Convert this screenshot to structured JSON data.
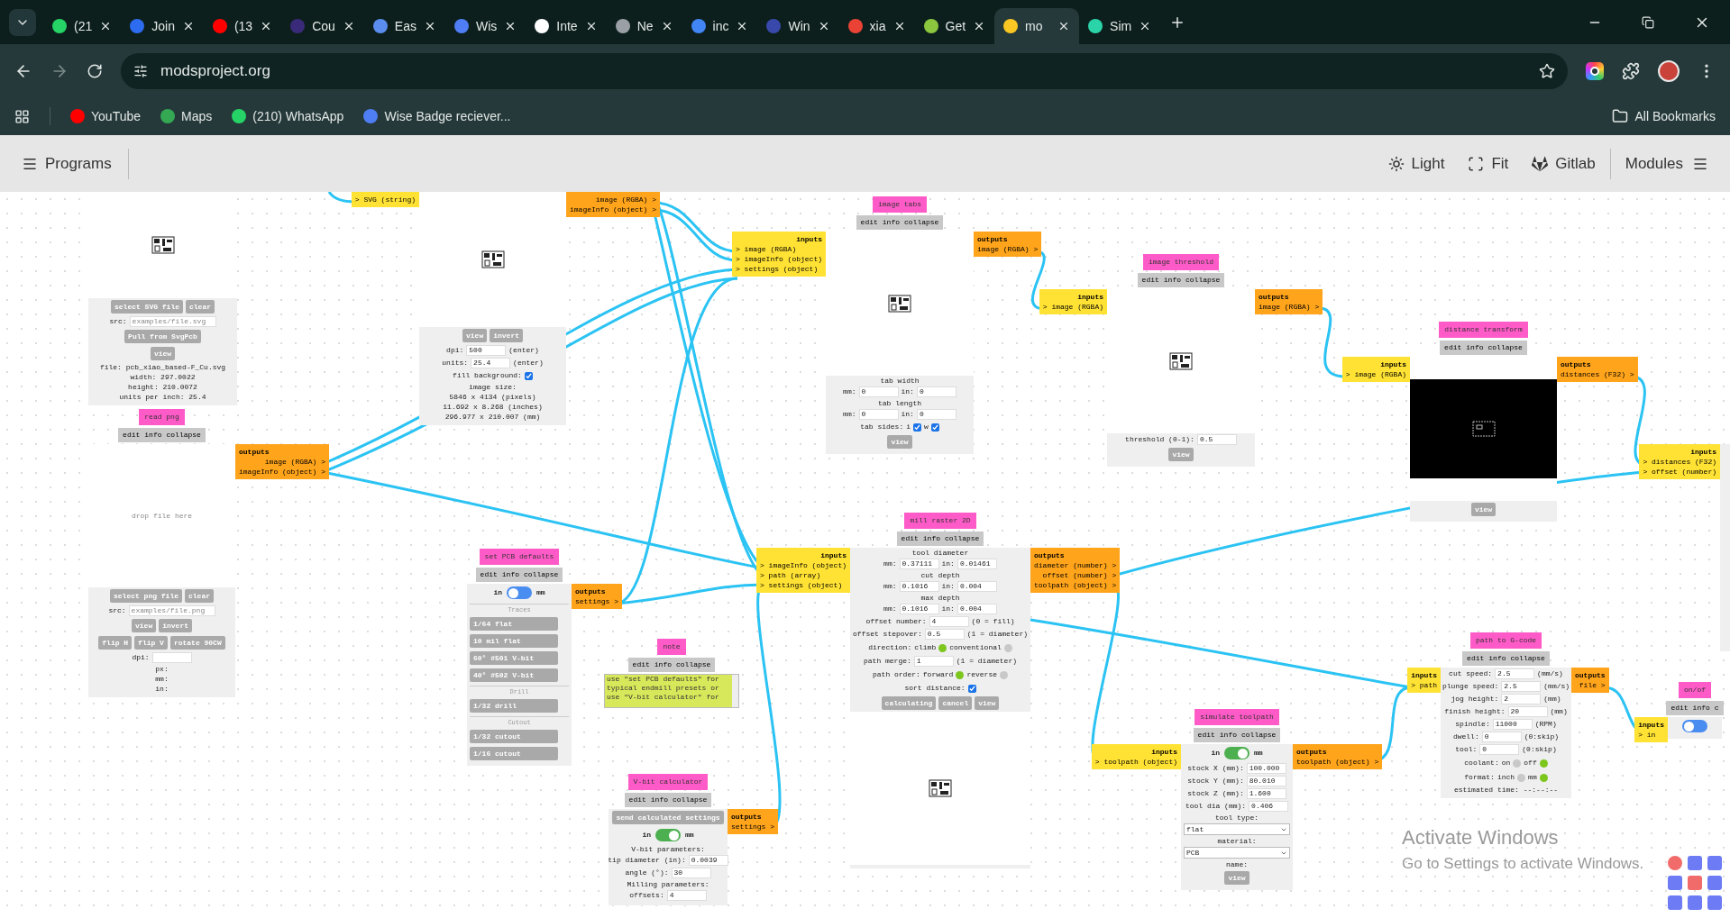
{
  "browser": {
    "tabs": [
      {
        "label": "(21",
        "color": "#25d366",
        "selected": false
      },
      {
        "label": "Join",
        "color": "#2d6bf0",
        "selected": false
      },
      {
        "label": "(13",
        "color": "#ff0000",
        "selected": false
      },
      {
        "label": "Cou",
        "color": "#3a2b7a",
        "selected": false
      },
      {
        "label": "Eas",
        "color": "#5b8def",
        "selected": false
      },
      {
        "label": "Wis",
        "color": "#4f7df3",
        "selected": false
      },
      {
        "label": "Inte",
        "color": "#ffffff",
        "selected": false
      },
      {
        "label": "Ne",
        "color": "#9aa0a6",
        "selected": false
      },
      {
        "label": "inc",
        "color": "#4285f4",
        "selected": false
      },
      {
        "label": "Win",
        "color": "#3949ab",
        "selected": false
      },
      {
        "label": "xia",
        "color": "#ea4335",
        "selected": false
      },
      {
        "label": "Get",
        "color": "#8cc63f",
        "selected": false
      },
      {
        "label": "mo",
        "color": "#f9c623",
        "selected": true
      },
      {
        "label": "Sim",
        "color": "#2ad4a8",
        "selected": false
      }
    ],
    "url": "modsproject.org",
    "bookmarks": [
      {
        "label": "YouTube",
        "color": "#ff0000"
      },
      {
        "label": "Maps",
        "color": "#34a853"
      },
      {
        "label": "(210) WhatsApp",
        "color": "#25d366"
      },
      {
        "label": "Wise Badge reciever...",
        "color": "#4f7df3"
      }
    ],
    "all_bookmarks": "All Bookmarks"
  },
  "header": {
    "programs": "Programs",
    "actions": [
      "Light",
      "Fit",
      "Gitlab"
    ],
    "modules": "Modules"
  },
  "nodes": [
    {
      "body": [
        {
          "kind": "image"
        },
        {
          "kind": "buttons",
          "items": [
            "select SVG file",
            "clear"
          ]
        },
        {
          "kind": "fields",
          "items": [
            {
              "label": "src:",
              "placeholder": "examples/file.svg"
            }
          ]
        },
        {
          "kind": "buttons",
          "items": [
            "Pull from SvgPcb"
          ]
        },
        {
          "kind": "buttons",
          "items": [
            "view"
          ]
        },
        {
          "kind": "text",
          "text": "file: pcb_xiao_based-F_Cu.svg"
        },
        {
          "kind": "text",
          "text": "width: 297.0022"
        },
        {
          "kind": "text",
          "text": "height: 210.0072"
        },
        {
          "kind": "text",
          "text": "units per inch: 25.4"
        }
      ]
    },
    {
      "inputs": {
        "ports": [
          "> SVG (string)"
        ]
      },
      "outputs": {
        "ports": [
          "image (RGBA) >",
          "imageInfo (object) >"
        ]
      },
      "body": [
        {
          "kind": "image"
        },
        {
          "kind": "buttons",
          "items": [
            "view",
            "invert"
          ]
        },
        {
          "kind": "fields",
          "items": [
            {
              "label": "dpi:",
              "value": "500",
              "suffix": "(enter)"
            }
          ]
        },
        {
          "kind": "fields",
          "items": [
            {
              "label": "units:",
              "value": "25.4",
              "suffix": "(enter)"
            }
          ]
        },
        {
          "kind": "checks",
          "label": "fill background:",
          "items": [
            {
              "checked": true
            }
          ]
        },
        {
          "kind": "text",
          "text": "image size:"
        },
        {
          "kind": "text",
          "text": "5846 x 4134 (pixels)"
        },
        {
          "kind": "text",
          "text": "11.692 x 8.268 (inches)"
        },
        {
          "kind": "text",
          "text": "296.977 x 210.007 (mm)"
        }
      ]
    },
    {
      "title": "read png",
      "menu": [
        "edit",
        "info",
        "collapse"
      ],
      "outputs": {
        "label": "outputs",
        "ports": [
          "image (RGBA) >",
          "imageInfo (object) >"
        ]
      },
      "body": [
        {
          "kind": "drop",
          "text": "drop file here"
        },
        {
          "kind": "buttons",
          "items": [
            "select png file",
            "clear"
          ]
        },
        {
          "kind": "fields",
          "items": [
            {
              "label": "src:",
              "placeholder": "examples/file.png"
            }
          ]
        },
        {
          "kind": "buttons",
          "items": [
            "view",
            "invert"
          ]
        },
        {
          "kind": "buttons",
          "items": [
            "flip H",
            "flip V",
            "rotate 90CW"
          ]
        },
        {
          "kind": "fields",
          "items": [
            {
              "label": "dpi:"
            }
          ]
        },
        {
          "kind": "text",
          "text": "px:"
        },
        {
          "kind": "text",
          "text": "mm:"
        },
        {
          "kind": "text",
          "text": "in:"
        }
      ]
    },
    {
      "title": "image tabs",
      "menu": [
        "edit",
        "info",
        "collapse"
      ],
      "inputs": {
        "label": "inputs",
        "ports": [
          "> image (RGBA)",
          "> imageInfo (object)",
          "> settings (object)"
        ]
      },
      "outputs": {
        "label": "outputs",
        "ports": [
          "image (RGBA) >"
        ]
      },
      "body": [
        {
          "kind": "image"
        },
        {
          "kind": "text",
          "text": "tab width"
        },
        {
          "kind": "fields",
          "items": [
            {
              "label": "mm:",
              "value": "0"
            },
            {
              "label": "in:",
              "value": "0"
            }
          ]
        },
        {
          "kind": "text",
          "text": "tab length"
        },
        {
          "kind": "fields",
          "items": [
            {
              "label": "mm:",
              "value": "0"
            },
            {
              "label": "in:",
              "value": "0"
            }
          ]
        },
        {
          "kind": "checks",
          "label": "tab sides:",
          "items": [
            {
              "label": "i",
              "checked": true
            },
            {
              "label": "w",
              "checked": true
            }
          ]
        },
        {
          "kind": "buttons",
          "items": [
            "view"
          ]
        }
      ]
    },
    {
      "title": "image threshold",
      "menu": [
        "edit",
        "info",
        "collapse"
      ],
      "inputs": {
        "label": "inputs",
        "ports": [
          "> image (RGBA)"
        ]
      },
      "outputs": {
        "label": "outputs",
        "ports": [
          "image (RGBA) >"
        ]
      },
      "body": [
        {
          "kind": "image"
        },
        {
          "kind": "fields",
          "items": [
            {
              "label": "threshold (0-1):",
              "value": "0.5"
            }
          ]
        },
        {
          "kind": "buttons",
          "items": [
            "view"
          ]
        }
      ]
    },
    {
      "title": "distance transform",
      "menu": [
        "edit",
        "info",
        "collapse"
      ],
      "inputs": {
        "label": "inputs",
        "ports": [
          "> image (RGBA)"
        ]
      },
      "outputs": {
        "label": "outputs",
        "ports": [
          "distances (F32) >"
        ]
      },
      "body": [
        {
          "kind": "dark"
        },
        {
          "kind": "buttons",
          "items": [
            "view"
          ]
        }
      ]
    },
    {
      "inputs": {
        "label": "inputs",
        "ports": [
          "> distances (F32)",
          "> offset (number)"
        ]
      }
    },
    {
      "title": "mill raster 2D",
      "menu": [
        "edit",
        "info",
        "collapse"
      ],
      "inputs": {
        "label": "inputs",
        "ports": [
          "> imageInfo (object)",
          "> path (array)",
          "> settings (object)"
        ]
      },
      "outputs": {
        "label": "outputs",
        "ports": [
          "diameter (number) >",
          "offset (number) >",
          "toolpath (object) >"
        ]
      },
      "body": [
        {
          "kind": "text",
          "text": "tool diameter"
        },
        {
          "kind": "fields",
          "items": [
            {
              "label": "mm:",
              "value": "0.37111"
            },
            {
              "label": "in:",
              "value": "0.01461"
            }
          ]
        },
        {
          "kind": "text",
          "text": "cut depth"
        },
        {
          "kind": "fields",
          "items": [
            {
              "label": "mm:",
              "value": "0.1016"
            },
            {
              "label": "in:",
              "value": "0.004"
            }
          ]
        },
        {
          "kind": "text",
          "text": "max depth"
        },
        {
          "kind": "fields",
          "items": [
            {
              "label": "mm:",
              "value": "0.1016"
            },
            {
              "label": "in:",
              "value": "0.004"
            }
          ]
        },
        {
          "kind": "fields",
          "items": [
            {
              "label": "offset number:",
              "value": "4",
              "suffix": "(0 = fill)"
            }
          ]
        },
        {
          "kind": "fields",
          "items": [
            {
              "label": "offset stepover:",
              "value": "0.5",
              "suffix": "(1 = diameter)"
            }
          ]
        },
        {
          "kind": "radio",
          "label": "direction:",
          "options": [
            {
              "label": "climb",
              "selected": true
            },
            {
              "label": "conventional",
              "selected": false
            }
          ]
        },
        {
          "kind": "fields",
          "items": [
            {
              "label": "path merge:",
              "value": "1",
              "suffix": "(1 = diameter)"
            }
          ]
        },
        {
          "kind": "radio",
          "label": "path order:",
          "options": [
            {
              "label": "forward",
              "selected": true
            },
            {
              "label": "reverse",
              "selected": false
            }
          ]
        },
        {
          "kind": "checks",
          "label": "sort distance:",
          "items": [
            {
              "checked": true
            }
          ]
        },
        {
          "kind": "buttons",
          "items": [
            "calculating",
            "cancel",
            "view"
          ]
        },
        {
          "kind": "image"
        }
      ]
    },
    {
      "title": "set PCB defaults",
      "menu": [
        "edit",
        "info",
        "collapse"
      ],
      "outputs": {
        "label": "outputs",
        "ports": [
          "settings >"
        ]
      },
      "body": [
        {
          "kind": "toggle",
          "left": "in",
          "right": "mm",
          "on": false
        },
        {
          "kind": "section",
          "text": "Traces"
        },
        {
          "kind": "presets",
          "items": [
            "1/64 flat",
            "10 mil flat",
            "60° #501 V-bit",
            "40° #502 V-bit"
          ]
        },
        {
          "kind": "section",
          "text": "Drill"
        },
        {
          "kind": "presets",
          "items": [
            "1/32 drill"
          ]
        },
        {
          "kind": "section",
          "text": "Cutout"
        },
        {
          "kind": "presets",
          "items": [
            "1/32 cutout",
            "1/16 cutout"
          ]
        }
      ]
    },
    {
      "title": "note",
      "menu": [
        "edit",
        "info",
        "collapse"
      ],
      "body": [
        {
          "kind": "note",
          "text": "use \"set PCB defaults\" for typical endmill presets or use \"V-bit calculator\" for"
        }
      ]
    },
    {
      "title": "V-bit calculator",
      "menu": [
        "edit",
        "info",
        "collapse"
      ],
      "outputs": {
        "label": "outputs",
        "ports": [
          "settings >"
        ]
      },
      "body": [
        {
          "kind": "buttons",
          "items": [
            "send calculated settings"
          ]
        },
        {
          "kind": "toggle",
          "left": "in",
          "right": "mm",
          "on": true
        },
        {
          "kind": "text",
          "text": "V-bit parameters:"
        },
        {
          "kind": "fields",
          "items": [
            {
              "label": "tip diameter (in):",
              "value": "0.0039"
            }
          ]
        },
        {
          "kind": "fields",
          "items": [
            {
              "label": "angle (°):",
              "value": "30"
            }
          ]
        },
        {
          "kind": "text",
          "text": "Milling parameters:"
        },
        {
          "kind": "fields",
          "items": [
            {
              "label": "offsets:",
              "value": "4"
            }
          ]
        }
      ]
    },
    {
      "title": "simulate toolpath",
      "menu": [
        "edit",
        "info",
        "collapse"
      ],
      "inputs": {
        "label": "inputs",
        "ports": [
          "> toolpath (object)"
        ]
      },
      "outputs": {
        "label": "outputs",
        "ports": [
          "toolpath (object) >"
        ]
      },
      "body": [
        {
          "kind": "toggle",
          "left": "in",
          "right": "mm",
          "on": true
        },
        {
          "kind": "fields",
          "items": [
            {
              "label": "stock X (mm):",
              "value": "100.000"
            }
          ]
        },
        {
          "kind": "fields",
          "items": [
            {
              "label": "stock Y (mm):",
              "value": "80.010"
            }
          ]
        },
        {
          "kind": "fields",
          "items": [
            {
              "label": "stock Z (mm):",
              "value": "1.600"
            }
          ]
        },
        {
          "kind": "fields",
          "items": [
            {
              "label": "tool dia (mm):",
              "value": "0.406"
            }
          ]
        },
        {
          "kind": "text",
          "text": "tool type:"
        },
        {
          "kind": "select",
          "value": "flat"
        },
        {
          "kind": "text",
          "text": "material:"
        },
        {
          "kind": "select",
          "value": "PCB"
        },
        {
          "kind": "text",
          "text": "name:"
        },
        {
          "kind": "buttons",
          "items": [
            "view"
          ]
        }
      ]
    },
    {
      "title": "path to G-code",
      "menu": [
        "edit",
        "info",
        "collapse"
      ],
      "inputs": {
        "label": "inputs",
        "ports": [
          "> path"
        ]
      },
      "outputs": {
        "label": "outputs",
        "ports": [
          "file >"
        ]
      },
      "body": [
        {
          "kind": "fields",
          "items": [
            {
              "label": "cut speed:",
              "value": "2.5",
              "suffix": "(mm/s)"
            }
          ]
        },
        {
          "kind": "fields",
          "items": [
            {
              "label": "plunge speed:",
              "value": "2.5",
              "suffix": "(mm/s)"
            }
          ]
        },
        {
          "kind": "fields",
          "items": [
            {
              "label": "jog height:",
              "value": "2",
              "suffix": "(mm)"
            }
          ]
        },
        {
          "kind": "fields",
          "items": [
            {
              "label": "finish height:",
              "value": "20",
              "suffix": "(mm)"
            }
          ]
        },
        {
          "kind": "fields",
          "items": [
            {
              "label": "spindle:",
              "value": "11000",
              "suffix": "(RPM)"
            }
          ]
        },
        {
          "kind": "fields",
          "items": [
            {
              "label": "dwell:",
              "value": "0",
              "suffix": "(0:skip)"
            }
          ]
        },
        {
          "kind": "fields",
          "items": [
            {
              "label": "tool:",
              "value": "0",
              "suffix": "(0:skip)"
            }
          ]
        },
        {
          "kind": "radio",
          "label": "coolant:",
          "options": [
            {
              "label": "on",
              "selected": false
            },
            {
              "label": "off",
              "selected": true
            }
          ]
        },
        {
          "kind": "radio",
          "label": "format:",
          "options": [
            {
              "label": "inch",
              "selected": false
            },
            {
              "label": "mm",
              "selected": true
            }
          ]
        },
        {
          "kind": "text",
          "text": "estimated time: --:--:--"
        }
      ]
    },
    {
      "title": "on/of",
      "menu": [
        "edit",
        "info",
        "c"
      ],
      "inputs": {
        "label": "inputs",
        "ports": [
          "> in"
        ]
      },
      "body": [
        {
          "kind": "toggle",
          "on": false
        }
      ]
    }
  ],
  "windows_notice": {
    "title": "Activate Windows",
    "text": "Go to Settings to activate Windows."
  }
}
